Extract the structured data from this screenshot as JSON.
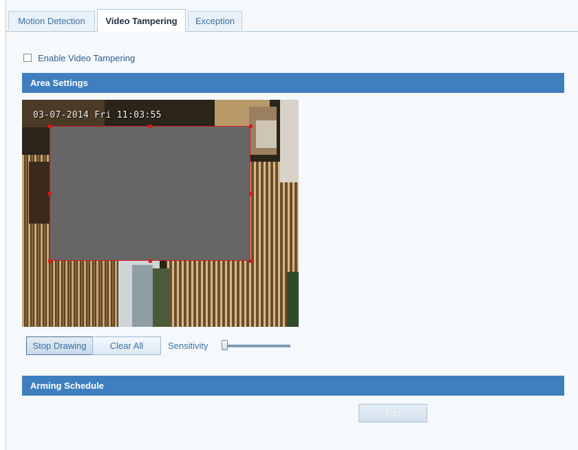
{
  "tabs": [
    {
      "label": "Motion Detection"
    },
    {
      "label": "Video Tampering"
    },
    {
      "label": "Exception"
    }
  ],
  "enable": {
    "label": "Enable Video Tampering",
    "checked": false
  },
  "area_settings": {
    "title": "Area Settings",
    "osd_text": "03-07-2014 Fri 11:03:55",
    "stop_drawing_label": "Stop Drawing",
    "clear_all_label": "Clear All",
    "sensitivity_label": "Sensitivity",
    "sensitivity_level": 0
  },
  "arming_schedule": {
    "title": "Arming Schedule",
    "edit_label": "Edit"
  },
  "colors": {
    "section_header": "#3f7fbf",
    "tamper_region": "#666666",
    "region_border": "#d11b1b"
  }
}
